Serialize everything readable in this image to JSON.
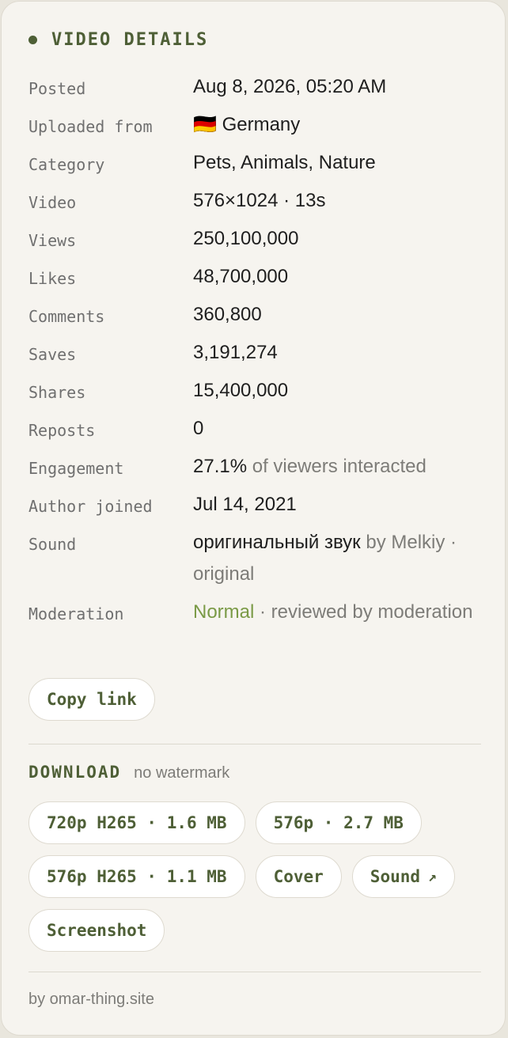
{
  "header": {
    "title": "VIDEO DETAILS"
  },
  "details": {
    "posted": {
      "label": "Posted",
      "value": "Aug 8, 2026, 05:20 AM"
    },
    "uploaded_from": {
      "label": "Uploaded from",
      "flag": "🇩🇪",
      "value": "Germany"
    },
    "category": {
      "label": "Category",
      "value": "Pets, Animals, Nature"
    },
    "video": {
      "label": "Video",
      "value": "576×1024 · 13s"
    },
    "views": {
      "label": "Views",
      "value": "250,100,000"
    },
    "likes": {
      "label": "Likes",
      "value": "48,700,000"
    },
    "comments": {
      "label": "Comments",
      "value": "360,800"
    },
    "saves": {
      "label": "Saves",
      "value": "3,191,274"
    },
    "shares": {
      "label": "Shares",
      "value": "15,400,000"
    },
    "reposts": {
      "label": "Reposts",
      "value": "0"
    },
    "engagement": {
      "label": "Engagement",
      "value": "27.1%",
      "suffix": " of viewers interacted"
    },
    "author_joined": {
      "label": "Author joined",
      "value": "Jul 14, 2021"
    },
    "sound": {
      "label": "Sound",
      "title": "оригинальный звук",
      "suffix": " by Melkiy · original"
    },
    "moderation": {
      "label": "Moderation",
      "status": "Normal",
      "suffix": " · reviewed by moderation"
    }
  },
  "actions": {
    "copy_link": "Copy link"
  },
  "download": {
    "title": "DOWNLOAD",
    "subtitle": "no watermark",
    "buttons": {
      "h265_720": "720p H265 · 1.6 MB",
      "p576": "576p · 2.7 MB",
      "h265_576": "576p H265 · 1.1 MB",
      "cover": "Cover",
      "sound": "Sound",
      "sound_arrow": "↗",
      "screenshot": "Screenshot"
    }
  },
  "footer": {
    "text": "by omar-thing.site"
  },
  "colors": {
    "accent": "#4e5f36",
    "status_green": "#7a9a46",
    "background": "#f6f4ef"
  }
}
